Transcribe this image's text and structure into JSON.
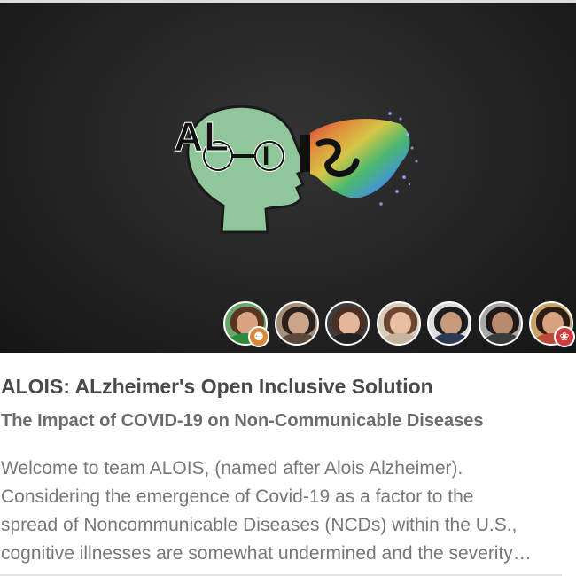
{
  "project": {
    "logo_alt": "ALOIS",
    "title": "ALOIS: ALzheimer's Open Inclusive Solution",
    "subtitle": "The Impact of COVID-19 on Non-Communicable Diseases",
    "description_lines": [
      "Welcome to team ALOIS, (named after Alois Alzheimer).",
      "Considering the emergence of Covid-19 as a factor to the",
      "spread of Noncommunicable Diseases (NCDs) within the U.S.,",
      "cognitive illnesses are somewhat undermined and the severity…"
    ]
  },
  "team": {
    "members": [
      {
        "name": "team-member-1",
        "badge": "team-group-icon",
        "skin": "#d9a382",
        "hair": "#5a3422",
        "shirt": "#2e8a3e",
        "bg": "#6aa86a"
      },
      {
        "name": "team-member-2",
        "badge": "",
        "skin": "#caa58a",
        "hair": "#2a211d",
        "shirt": "#5b4a3c",
        "bg": "#a58f78"
      },
      {
        "name": "team-member-3",
        "badge": "",
        "skin": "#e4b69b",
        "hair": "#4b2f22",
        "shirt": "#222222",
        "bg": "#3c3c3c"
      },
      {
        "name": "team-member-4",
        "badge": "",
        "skin": "#e8bea3",
        "hair": "#6b4630",
        "shirt": "#c8b4a0",
        "bg": "#d9cbbd"
      },
      {
        "name": "team-member-5",
        "badge": "",
        "skin": "#c89a7c",
        "hair": "#1d1d1d",
        "shirt": "#2e3a55",
        "bg": "#dcdcdc"
      },
      {
        "name": "team-member-6",
        "badge": "",
        "skin": "#b88a6e",
        "hair": "#1f1a18",
        "shirt": "#3b3b3b",
        "bg": "#a9a9a9"
      },
      {
        "name": "team-member-7",
        "badge": "lightbulb-icon",
        "skin": "#d8a27f",
        "hair": "#2b1d16",
        "shirt": "#b84a38",
        "bg": "#c9a36a"
      }
    ]
  },
  "colors": {
    "hero_bg": "#262626",
    "title": "#4a4a4a",
    "subtitle": "#6b6b6b",
    "body": "#777777",
    "badge_group": "#d9883c",
    "badge_bulb": "#d23b3b"
  }
}
